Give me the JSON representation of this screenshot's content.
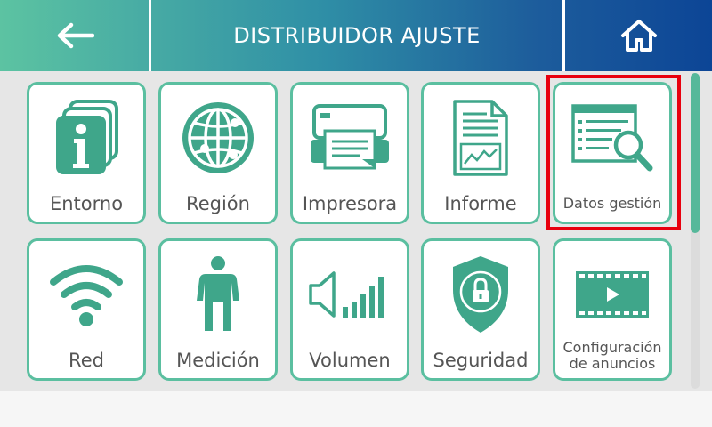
{
  "header": {
    "title": "DISTRIBUIDOR AJUSTE",
    "back_icon": "arrow-left-icon",
    "home_icon": "home-icon"
  },
  "colors": {
    "accent": "#5bbfa0",
    "header_start": "#5cc3a2",
    "header_end": "#0c4596",
    "highlight": "#e8000e"
  },
  "tiles": [
    {
      "label": "Entorno",
      "icon": "info-cards-icon"
    },
    {
      "label": "Región",
      "icon": "globe-icon"
    },
    {
      "label": "Impresora",
      "icon": "printer-icon"
    },
    {
      "label": "Informe",
      "icon": "report-document-icon"
    },
    {
      "label": "Datos gestión",
      "icon": "data-search-icon"
    },
    {
      "label": "Red",
      "icon": "wifi-icon"
    },
    {
      "label": "Medición",
      "icon": "person-icon"
    },
    {
      "label": "Volumen",
      "icon": "volume-icon"
    },
    {
      "label": "Seguridad",
      "icon": "shield-lock-icon"
    },
    {
      "label_line1": "Configuración",
      "label_line2": "de anuncios",
      "icon": "video-film-icon"
    }
  ]
}
